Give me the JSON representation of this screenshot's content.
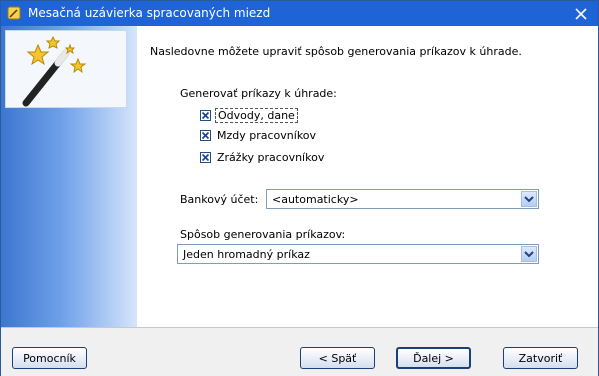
{
  "window": {
    "title": "Mesačná uzávierka spracovaných miezd",
    "close_glyph": "✕"
  },
  "content": {
    "intro": "Nasledovne môžete upraviť spôsob generovania príkazov k úhrade.",
    "group_label": "Generovať príkazy k úhrade:",
    "checkboxes": [
      {
        "label": "Odvody, dane",
        "checked": true,
        "focused": true
      },
      {
        "label": "Mzdy pracovníkov",
        "checked": true,
        "focused": false
      },
      {
        "label": "Zrážky pracovníkov",
        "checked": true,
        "focused": false
      }
    ],
    "bank_label": "Bankový účet:",
    "bank_value": "<automaticky>",
    "method_label": "Spôsob generovania príkazov:",
    "method_value": "Jeden hromadný príkaz"
  },
  "buttons": {
    "help": "Pomocník",
    "back": "< Späť",
    "next": "Ďalej >",
    "close": "Zatvoriť"
  },
  "icons": {
    "wizard": "magic-wand-icon",
    "dropdown": "chevron-down-icon"
  },
  "colors": {
    "titlebar": "#1f64d6",
    "side_panel": "#3d76cf"
  }
}
